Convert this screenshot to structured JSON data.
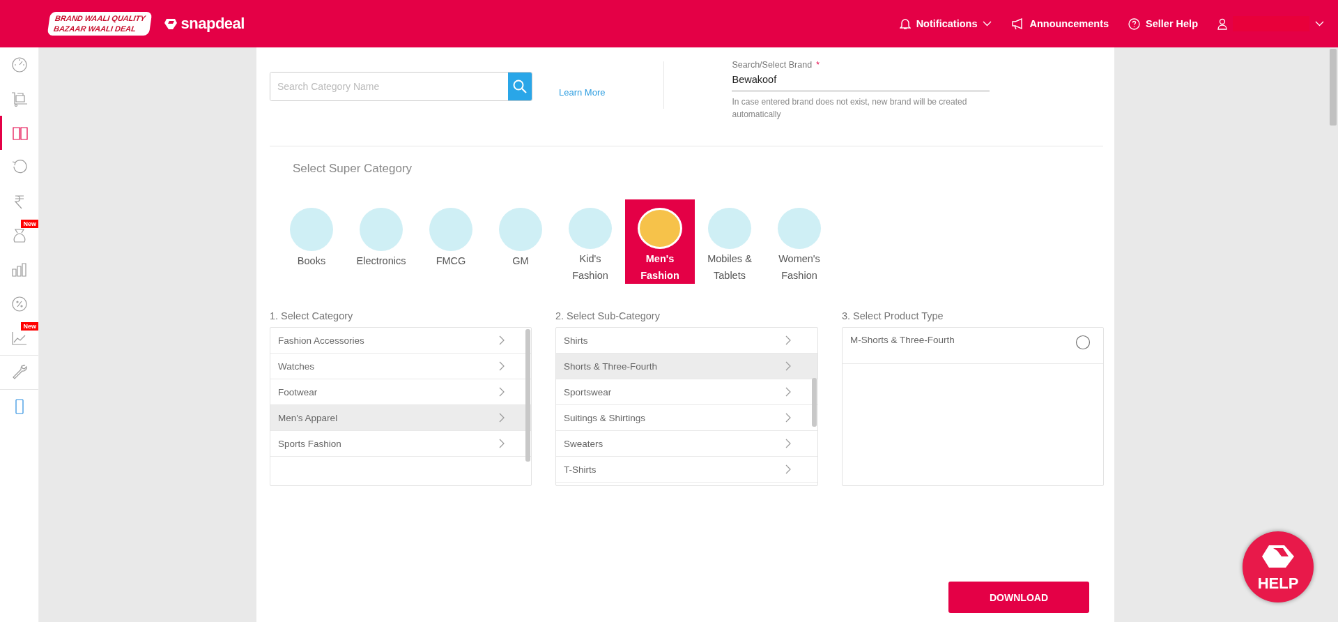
{
  "header": {
    "logo": {
      "line_1": "BRAND WAALI QUALITY",
      "line_2": "BAZAAR WAALI DEAL",
      "brand": "snapdeal"
    },
    "nav": [
      {
        "label": "Notifications",
        "dropdown": true
      },
      {
        "label": "Announcements",
        "dropdown": false
      },
      {
        "label": "Seller Help",
        "dropdown": false
      }
    ],
    "user": {
      "dropdown": true
    }
  },
  "sidebar": {
    "items": [
      {
        "selected": false
      },
      {
        "selected": false
      },
      {
        "selected": true
      },
      {
        "selected": false
      },
      {
        "selected": false
      },
      {
        "selected": false,
        "badge": "New"
      },
      {
        "selected": false
      },
      {
        "selected": false
      },
      {
        "selected": false,
        "badge": "New"
      },
      {
        "selected": false
      },
      {
        "selected": false
      }
    ]
  },
  "search": {
    "placeholder": "Search Category Name",
    "link": "Learn More"
  },
  "brand_field": {
    "label": "Search/Select Brand",
    "required": "*",
    "value": "Bewakoof",
    "hint": "In case entered brand does not exist, new brand will be created automatically"
  },
  "super_category": {
    "title": "Select Super Category",
    "items": [
      {
        "label": "Books",
        "selected": false
      },
      {
        "label": "Electronics",
        "selected": false
      },
      {
        "label": "FMCG",
        "selected": false
      },
      {
        "label": "GM",
        "selected": false
      },
      {
        "label": "Kid's Fashion",
        "selected": false
      },
      {
        "label": "Men's Fashion",
        "selected": true
      },
      {
        "label": "Mobiles & Tablets",
        "selected": false
      },
      {
        "label": "Women's Fashion",
        "selected": false
      }
    ]
  },
  "columns": [
    {
      "title": "1. Select Category",
      "kind": "nav",
      "rows": [
        {
          "label": "Fashion Accessories",
          "selected": false
        },
        {
          "label": "Watches",
          "selected": false
        },
        {
          "label": "Footwear",
          "selected": false
        },
        {
          "label": "Men's Apparel",
          "selected": true
        },
        {
          "label": "Sports Fashion",
          "selected": false
        }
      ]
    },
    {
      "title": "2. Select Sub-Category",
      "kind": "nav",
      "rows": [
        {
          "label": "Shirts",
          "selected": false
        },
        {
          "label": "Shorts & Three-Fourth",
          "selected": true
        },
        {
          "label": "Sportswear",
          "selected": false
        },
        {
          "label": "Suitings & Shirtings",
          "selected": false
        },
        {
          "label": "Sweaters",
          "selected": false
        },
        {
          "label": "T-Shirts",
          "selected": false
        }
      ]
    },
    {
      "title": "3. Select Product Type",
      "kind": "radio",
      "rows": [
        {
          "label": "M-Shorts & Three-Fourth",
          "selected": false
        }
      ]
    }
  ],
  "download_button": "DOWNLOAD",
  "help_button": "HELP"
}
